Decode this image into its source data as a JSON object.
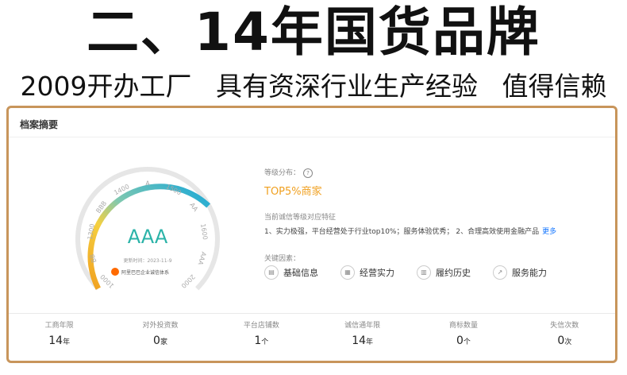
{
  "headline": "二、14年国货品牌",
  "subline": [
    "2009开办工厂",
    "具有资深行业生产经验",
    "值得信赖"
  ],
  "card": {
    "title": "档案摘要",
    "gauge": {
      "grade": "AAA",
      "update_text": "更新时间：2023-11-9",
      "system_text": "阿里巴巴企业诚信体系",
      "ticks": [
        "1000",
        "BB",
        "1300",
        "BBB",
        "1400",
        "A",
        "1500",
        "AA",
        "1600",
        "AAA",
        "2000"
      ]
    },
    "rank_label": "等级分布：",
    "help_glyph": "?",
    "rank_value": "TOP5%商家",
    "verification_label": "当前诚信等级对应特征",
    "verification_text": "1、实力极强，平台经营处于行业top10%；服务体验优秀； 2、合理高效使用金融产品",
    "more_link": "更多",
    "factors_label": "关键因素：",
    "factors": [
      {
        "icon": "info-icon",
        "label": "基础信息"
      },
      {
        "icon": "chart-icon",
        "label": "经营实力"
      },
      {
        "icon": "document-icon",
        "label": "履约历史"
      },
      {
        "icon": "trend-icon",
        "label": "服务能力"
      }
    ],
    "stats": [
      {
        "label": "工商年限",
        "value": "14",
        "unit": "年"
      },
      {
        "label": "对外投资数",
        "value": "0",
        "unit": "家"
      },
      {
        "label": "平台店铺数",
        "value": "1",
        "unit": "个"
      },
      {
        "label": "诚信通年限",
        "value": "14",
        "unit": "年"
      },
      {
        "label": "商标数量",
        "value": "0",
        "unit": "个"
      },
      {
        "label": "失信次数",
        "value": "0",
        "unit": "次"
      }
    ],
    "colors": {
      "accent_orange": "#f0a020",
      "grade_teal": "#2bb3a8",
      "frame": "#c8955b",
      "link": "#1677ff"
    }
  }
}
